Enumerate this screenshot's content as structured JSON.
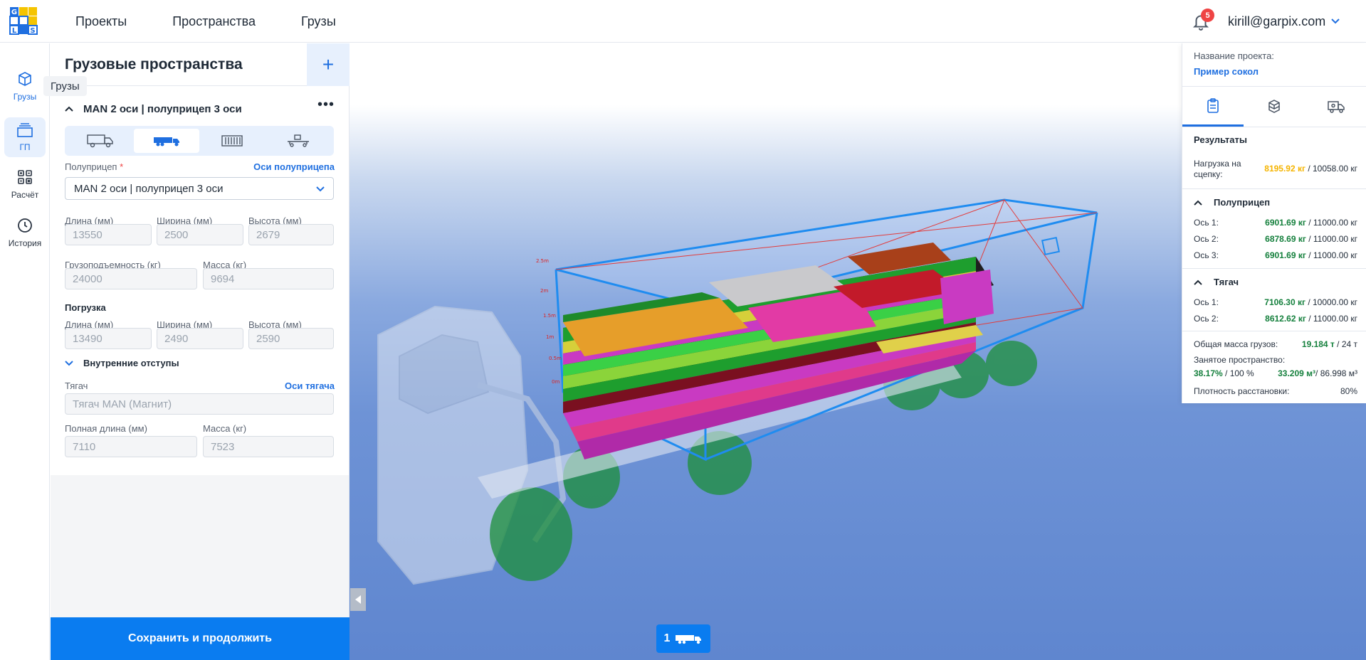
{
  "header": {
    "nav": [
      "Проекты",
      "Пространства",
      "Грузы"
    ],
    "notifications_count": "5",
    "user_email": "kirill@garpix.com",
    "logo_letters": [
      "G",
      "L",
      "S"
    ]
  },
  "rail": {
    "items": [
      {
        "label": "Грузы",
        "icon": "cargo-box-icon"
      },
      {
        "label": "ГП",
        "icon": "cargo-space-icon"
      },
      {
        "label": "Расчёт",
        "icon": "calculation-grid-icon"
      },
      {
        "label": "История",
        "icon": "history-clock-icon"
      }
    ],
    "tooltip": "Грузы"
  },
  "panel": {
    "title": "Грузовые пространства",
    "add_label": "+",
    "space_name": "MAN 2 оси | полуприцеп 3 оси",
    "types": [
      "truck-icon",
      "semitrailer-icon",
      "container-icon",
      "platform-icon"
    ],
    "semitrailer_label": "Полуприцеп",
    "semitrailer_axes_link": "Оси полуприцепа",
    "semitrailer_value": "MAN 2 оси | полуприцеп 3 оси",
    "length_label": "Длина (мм)",
    "width_label": "Ширина (мм)",
    "height_label": "Высота (мм)",
    "length": "13550",
    "width": "2500",
    "height": "2679",
    "capacity_label": "Грузоподъемность (кг)",
    "mass_label": "Масса (кг)",
    "capacity": "24000",
    "mass": "9694",
    "loading_title": "Погрузка",
    "load_length": "13490",
    "load_width": "2490",
    "load_height": "2590",
    "inner_offsets": "Внутренние отступы",
    "tractor_label": "Тягач",
    "tractor_axes_link": "Оси тягача",
    "tractor_placeholder": "Тягач MAN (Магнит)",
    "full_length_label": "Полная длина (мм)",
    "tractor_mass_label": "Масса (кг)",
    "full_length": "7110",
    "tractor_mass": "7523",
    "save_label": "Сохранить и продолжить"
  },
  "viewport": {
    "vehicle_count": "1",
    "scale_labels": [
      "2.5m",
      "2m",
      "1.5m",
      "1m",
      "0.5m",
      "0m"
    ]
  },
  "results": {
    "project_label": "Название проекта:",
    "project_name": "Пример сокол",
    "tabs": [
      "clipboard-icon",
      "boxes-icon",
      "truck-settings-icon"
    ],
    "title": "Результаты",
    "hitch_label": "Нагрузка на сцепку:",
    "hitch_value": "8195.92 кг",
    "hitch_max": " / 10058.00 кг",
    "semitrailer_group": "Полуприцеп",
    "semitrailer_axes": [
      {
        "label": "Ось 1:",
        "value": "6901.69 кг",
        "max": " / 11000.00 кг"
      },
      {
        "label": "Ось 2:",
        "value": "6878.69 кг",
        "max": " / 11000.00 кг"
      },
      {
        "label": "Ось 3:",
        "value": "6901.69 кг",
        "max": " / 11000.00 кг"
      }
    ],
    "tractor_group": "Тягач",
    "tractor_axes": [
      {
        "label": "Ось 1:",
        "value": "7106.30 кг",
        "max": " / 10000.00 кг"
      },
      {
        "label": "Ось 2:",
        "value": "8612.62 кг",
        "max": " / 11000.00 кг"
      }
    ],
    "total_mass_label": "Общая масса грузов:",
    "total_mass_value": "19.184 т",
    "total_mass_max": " / 24 т",
    "occupied_label": "Занятое пространство:",
    "occupied_pct": "38.17%",
    "occupied_pct_max": " / 100 %",
    "occupied_vol": "33.209 м³",
    "occupied_vol_max": "/ 86.998 м³",
    "density_label": "Плотность расстановки:",
    "density_value": "80%"
  },
  "colors": {
    "accent": "#0a7cf0",
    "ok": "#15803d",
    "warn": "#f5b400"
  }
}
